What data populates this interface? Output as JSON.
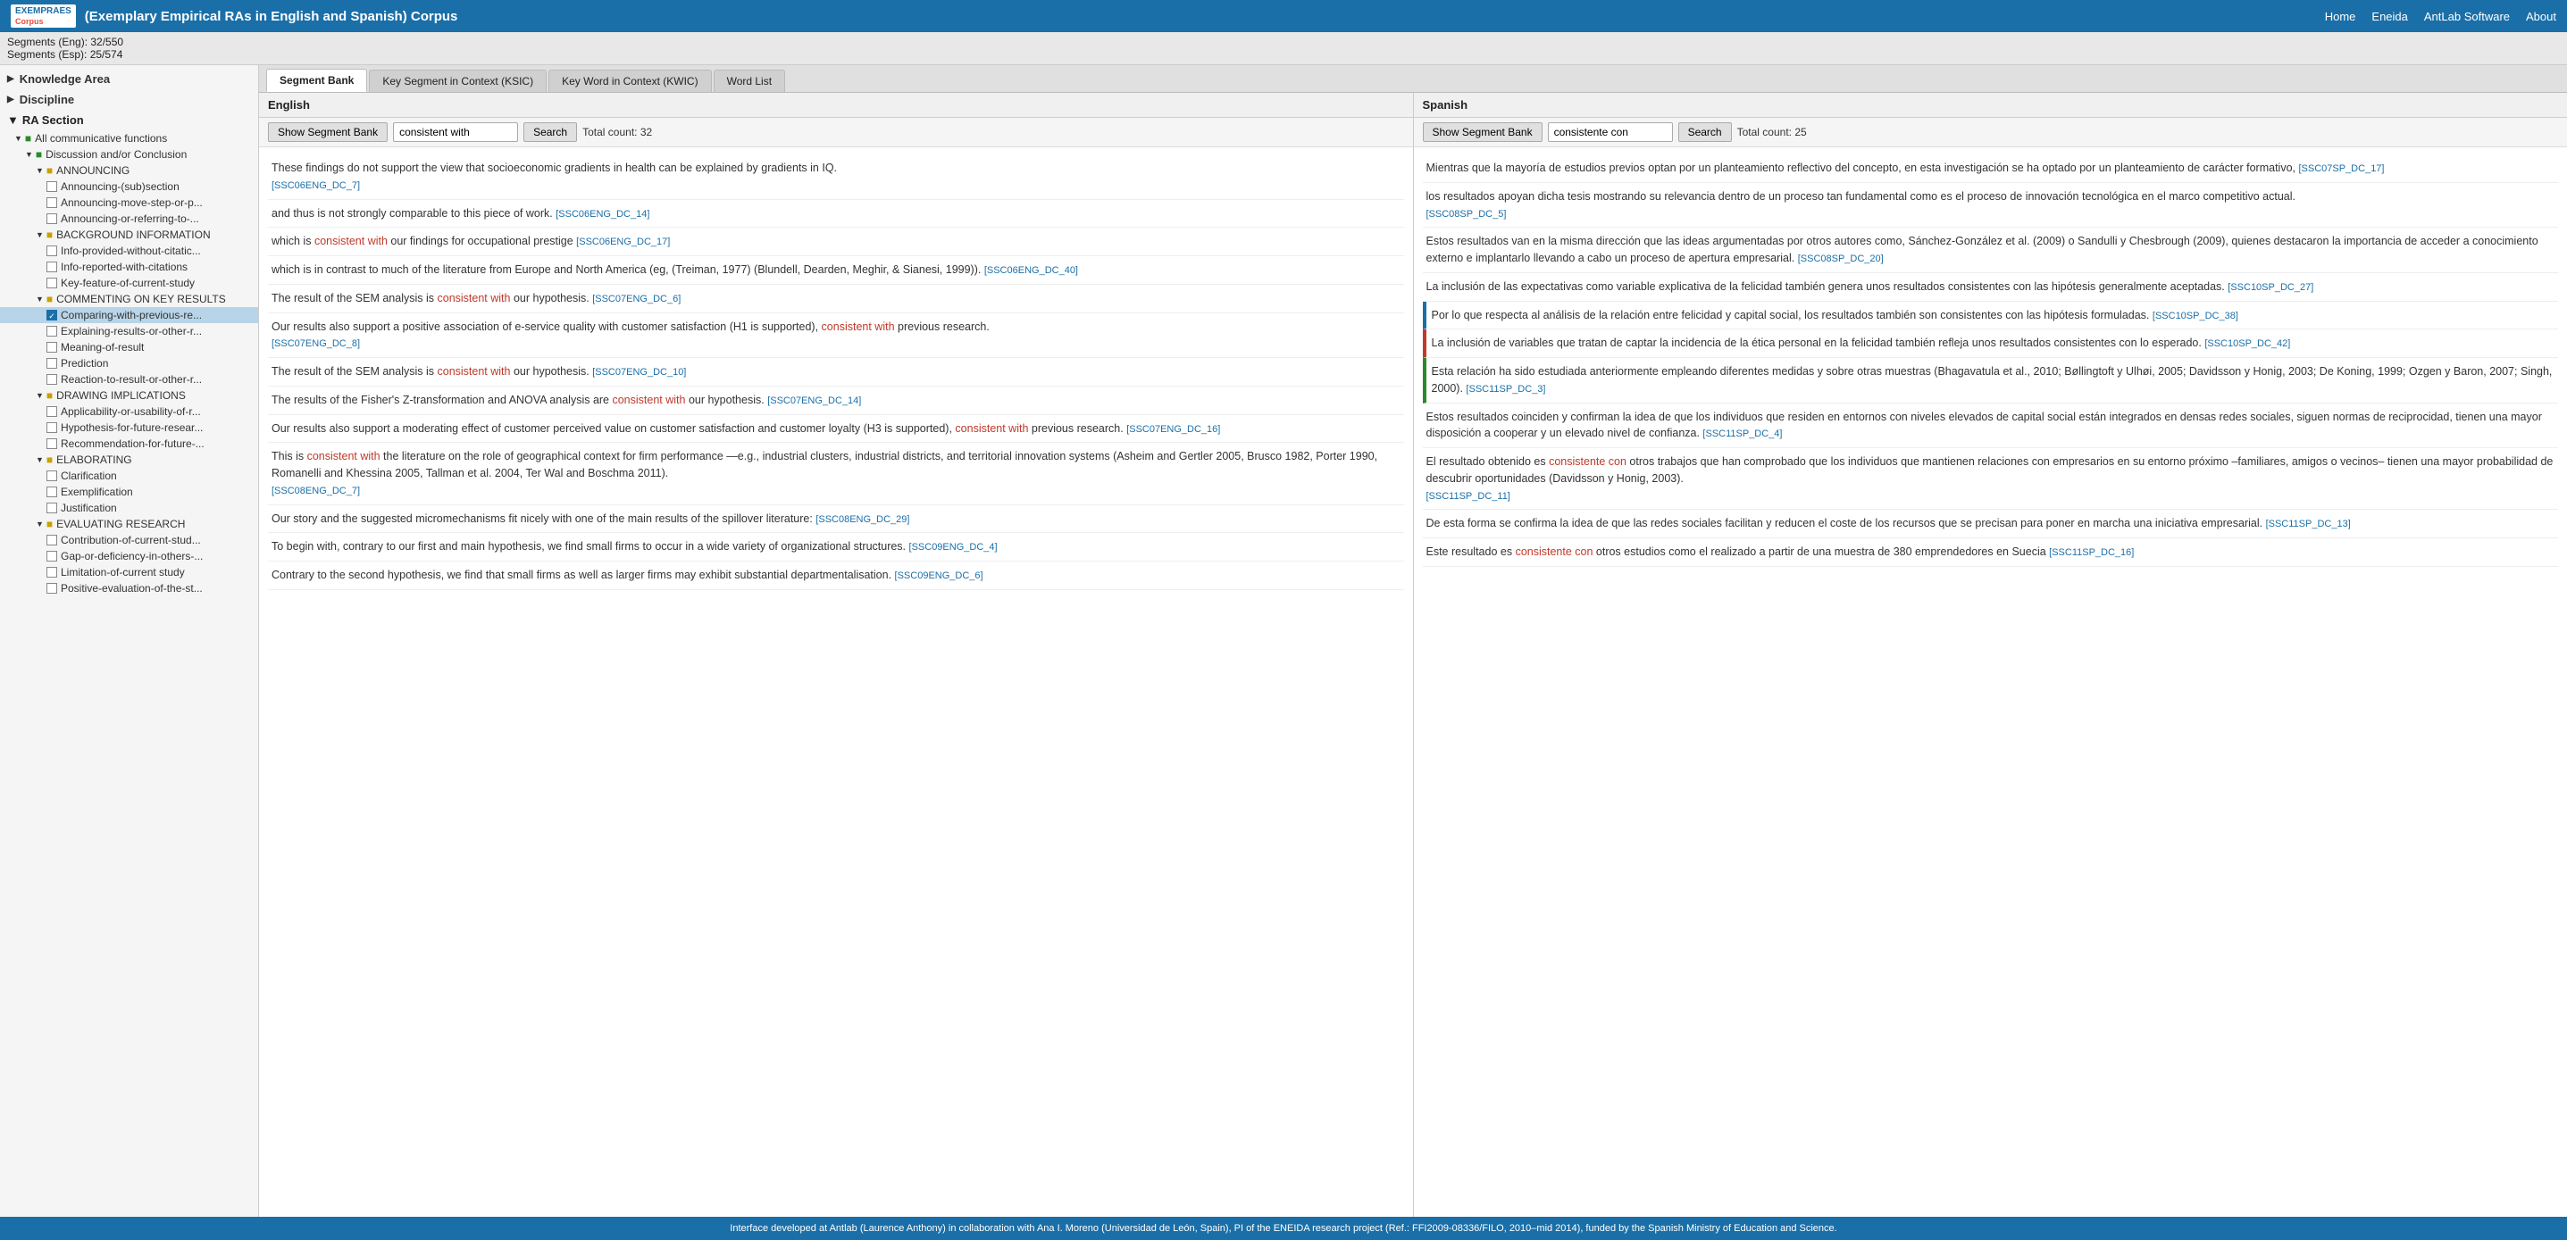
{
  "header": {
    "logo_line1": "EXEMPRAES",
    "logo_line2": "Corpus",
    "title": "(Exemplary Empirical RAs in English and Spanish) Corpus",
    "nav": [
      "Home",
      "Eneida",
      "AntLab Software",
      "About"
    ]
  },
  "subheader": {
    "eng": "Segments (Eng): 32/550",
    "esp": "Segments (Esp): 25/574"
  },
  "sidebar": {
    "knowledge_area_label": "Knowledge Area",
    "discipline_label": "Discipline",
    "ra_section_label": "RA Section",
    "tree_items": [
      {
        "label": "All communicative functions",
        "level": 1,
        "type": "folder-green",
        "expanded": true
      },
      {
        "label": "Discussion and/or Conclusion",
        "level": 2,
        "type": "folder-green",
        "expanded": true
      },
      {
        "label": "ANNOUNCING",
        "level": 3,
        "type": "folder-yellow",
        "expanded": true
      },
      {
        "label": "Announcing-(sub)section",
        "level": 4,
        "type": "checkbox"
      },
      {
        "label": "Announcing-move-step-or-p...",
        "level": 4,
        "type": "checkbox"
      },
      {
        "label": "Announcing-or-referring-to-...",
        "level": 4,
        "type": "checkbox"
      },
      {
        "label": "BACKGROUND INFORMATION",
        "level": 3,
        "type": "folder-yellow",
        "expanded": true
      },
      {
        "label": "Info-provided-without-citatic...",
        "level": 4,
        "type": "checkbox"
      },
      {
        "label": "Info-reported-with-citations",
        "level": 4,
        "type": "checkbox"
      },
      {
        "label": "Key-feature-of-current-study",
        "level": 4,
        "type": "checkbox"
      },
      {
        "label": "COMMENTING ON KEY RESULTS",
        "level": 3,
        "type": "folder-yellow",
        "expanded": true
      },
      {
        "label": "Comparing-with-previous-re...",
        "level": 4,
        "type": "checkbox",
        "checked": true,
        "selected": true
      },
      {
        "label": "Explaining-results-or-other-r...",
        "level": 4,
        "type": "checkbox"
      },
      {
        "label": "Meaning-of-result",
        "level": 4,
        "type": "checkbox"
      },
      {
        "label": "Prediction",
        "level": 4,
        "type": "checkbox"
      },
      {
        "label": "Reaction-to-result-or-other-r...",
        "level": 4,
        "type": "checkbox"
      },
      {
        "label": "DRAWING IMPLICATIONS",
        "level": 3,
        "type": "folder-yellow",
        "expanded": true
      },
      {
        "label": "Applicability-or-usability-of-r...",
        "level": 4,
        "type": "checkbox"
      },
      {
        "label": "Hypothesis-for-future-resear...",
        "level": 4,
        "type": "checkbox"
      },
      {
        "label": "Recommendation-for-future-...",
        "level": 4,
        "type": "checkbox"
      },
      {
        "label": "ELABORATING",
        "level": 3,
        "type": "folder-yellow",
        "expanded": true
      },
      {
        "label": "Clarification",
        "level": 4,
        "type": "checkbox"
      },
      {
        "label": "Exemplification",
        "level": 4,
        "type": "checkbox"
      },
      {
        "label": "Justification",
        "level": 4,
        "type": "checkbox"
      },
      {
        "label": "EVALUATING RESEARCH",
        "level": 3,
        "type": "folder-yellow",
        "expanded": true
      },
      {
        "label": "Contribution-of-current-stud...",
        "level": 4,
        "type": "checkbox"
      },
      {
        "label": "Gap-or-deficiency-in-others-...",
        "level": 4,
        "type": "checkbox"
      },
      {
        "label": "Limitation-of-current study",
        "level": 4,
        "type": "checkbox"
      },
      {
        "label": "Positive-evaluation-of-the-st...",
        "level": 4,
        "type": "checkbox"
      }
    ]
  },
  "tabs": [
    {
      "label": "Segment Bank",
      "active": true
    },
    {
      "label": "Key Segment in Context (KSIC)",
      "active": false
    },
    {
      "label": "Key Word in Context (KWIC)",
      "active": false
    },
    {
      "label": "Word List",
      "active": false
    }
  ],
  "english_panel": {
    "lang_label": "English",
    "show_segment_bank_btn": "Show Segment Bank",
    "search_placeholder": "consistent with",
    "search_btn": "Search",
    "total_count": "Total count: 32",
    "segments": [
      {
        "text": "These findings do not support the view that socioeconomic gradients in health can be explained by gradients in IQ.</p>",
        "ref": "[SSC06ENG_DC_7]",
        "highlight": null
      },
      {
        "text": "and thus is not strongly comparable to this piece of work.",
        "ref": "[SSC06ENG_DC_14]",
        "highlight": null
      },
      {
        "text": "which is consistent with our findings for occupational prestige",
        "ref": "[SSC06ENG_DC_17]",
        "highlight": "consistent with"
      },
      {
        "text": "which is in contrast to much of the literature from Europe and North America (eg, (Treiman, 1977) (Blundell, Dearden, Meghir, & Sianesi, 1999)).",
        "ref": "[SSC06ENG_DC_40]",
        "highlight": null
      },
      {
        "text": "The result of the SEM analysis is consistent with our hypothesis.",
        "ref": "[SSC07ENG_DC_6]",
        "highlight": "consistent with"
      },
      {
        "text": "Our results also support a positive association of e-service quality with customer satisfaction (H1 is supported), consistent with previous research.</p>",
        "ref": "[SSC07ENG_DC_8]",
        "highlight": "consistent with"
      },
      {
        "text": "The result of the SEM analysis is consistent with our hypothesis.",
        "ref": "[SSC07ENG_DC_10]",
        "highlight": "consistent with"
      },
      {
        "text": "The results of the Fisher's Z-transformation and ANOVA analysis are consistent with our hypothesis.",
        "ref": "[SSC07ENG_DC_14]",
        "highlight": "consistent with"
      },
      {
        "text": "Our results also support a moderating effect of customer perceived value on customer satisfaction and customer loyalty (H3 is supported), consistent with previous research.",
        "ref": "[SSC07ENG_DC_16]",
        "highlight": "consistent with"
      },
      {
        "text": "This is consistent with the literature on the role of geographical context for firm performance —e.g., industrial clusters, industrial districts, and territorial innovation systems (Asheim and Gertler 2005, Brusco 1982, Porter 1990, Romanelli and Khessina 2005, Tallman et al. 2004, Ter Wal and Boschma 2011).</p>",
        "ref": "[SSC08ENG_DC_7]",
        "highlight": "consistent with"
      },
      {
        "text": "Our story and the suggested micromechanisms fit nicely with one of the main results of the spillover literature:",
        "ref": "[SSC08ENG_DC_29]",
        "highlight": null
      },
      {
        "text": "<p>To begin with, contrary to our first and main hypothesis, we find small firms to occur in a wide variety of organizational structures.",
        "ref": "[SSC09ENG_DC_4]",
        "highlight": null
      },
      {
        "text": "Contrary to the second hypothesis, we find that small firms as well as larger firms may exhibit substantial departmentalisation.",
        "ref": "[SSC09ENG_DC_6]",
        "highlight": null
      }
    ]
  },
  "spanish_panel": {
    "lang_label": "Spanish",
    "show_segment_bank_btn": "Show Segment Bank",
    "search_placeholder": "consistente con",
    "search_btn": "Search",
    "total_count": "Total count: 25",
    "segments": [
      {
        "text": "Mientras que la mayoría de estudios previos optan por un planteamiento reflectivo del concepto, en esta investigación se ha optado por un planteamiento de carácter formativo,",
        "ref": "[SSC07SP_DC_17]",
        "highlight": null,
        "color_bar": null
      },
      {
        "text": "los resultados apoyan dicha tesis mostrando su relevancia dentro de un proceso tan fundamental como es el proceso de innovación tecnológica en el marco competitivo actual.</p>",
        "ref": "[SSC08SP_DC_5]",
        "highlight": null,
        "color_bar": null
      },
      {
        "text": "<p>Estos resultados van en la misma dirección que las ideas argumentadas por otros autores como, Sánchez-González et al. (2009) o Sandulli y Chesbrough (2009), quienes destacaron la importancia de acceder a conocimiento externo e implantarlo llevando a cabo un proceso de apertura empresarial.",
        "ref": "[SSC08SP_DC_20]",
        "highlight": null,
        "color_bar": null
      },
      {
        "text": "La inclusión de las expectativas como variable explicativa de la felicidad también genera unos resultados consistentes con las hipótesis generalmente aceptadas.",
        "ref": "[SSC10SP_DC_27]",
        "highlight": null,
        "color_bar": null
      },
      {
        "text": "<p>Por lo que respecta al análisis de la relación entre felicidad y capital social, los resultados también son consistentes con las hipótesis formuladas.",
        "ref": "[SSC10SP_DC_38]",
        "highlight": null,
        "color_bar": "blue"
      },
      {
        "text": "<p>La inclusión de variables que tratan de captar la incidencia de la ética personal en la felicidad también refleja unos resultados consistentes con lo esperado.",
        "ref": "[SSC10SP_DC_42]",
        "highlight": null,
        "color_bar": "red"
      },
      {
        "text": "Esta relación ha sido estudiada anteriormente empleando diferentes medidas y sobre otras muestras (Bhagavatula et al., 2010; Bøllingtoft y Ulhøi, 2005; Davidsson y Honig, 2003; De Koning, 1999; Ozgen y Baron, 2007; Singh, 2000).",
        "ref": "[SSC11SP_DC_3]",
        "highlight": null,
        "color_bar": "green"
      },
      {
        "text": "Estos resultados coinciden y confirman la idea de que los individuos que residen en entornos con niveles elevados de capital social están integrados en densas redes sociales, siguen normas de reciprocidad, tienen una mayor disposición a cooperar y un elevado nivel de confianza.",
        "ref": "[SSC11SP_DC_4]",
        "highlight": null,
        "color_bar": null
      },
      {
        "text": "El resultado obtenido es consistente con otros trabajos que han comprobado que los individuos que mantienen relaciones con empresarios en su entorno próximo –familiares, amigos o vecinos– tienen una mayor probabilidad de descubrir oportunidades (Davidsson y Honig, 2003).</p>",
        "ref": "[SSC11SP_DC_11]",
        "highlight": "consistente con",
        "color_bar": null
      },
      {
        "text": "De esta forma se confirma la idea de que las redes sociales facilitan y reducen el coste de los recursos que se precisan para poner en marcha una iniciativa empresarial.",
        "ref": "[SSC11SP_DC_13]",
        "highlight": null,
        "color_bar": null
      },
      {
        "text": "Este resultado es consistente con otros estudios como el realizado a partir de una muestra de 380 emprendedores en Suecia",
        "ref": "[SSC11SP_DC_16]",
        "highlight": "consistente con",
        "color_bar": null
      }
    ]
  },
  "footer": {
    "text": "Interface developed at Antlab (Laurence Anthony) in collaboration with Ana I. Moreno (Universidad de León, Spain), PI of the ENEIDA research project (Ref.: FFI2009-08336/FILO, 2010–mid 2014), funded by the Spanish Ministry of Education and Science."
  }
}
